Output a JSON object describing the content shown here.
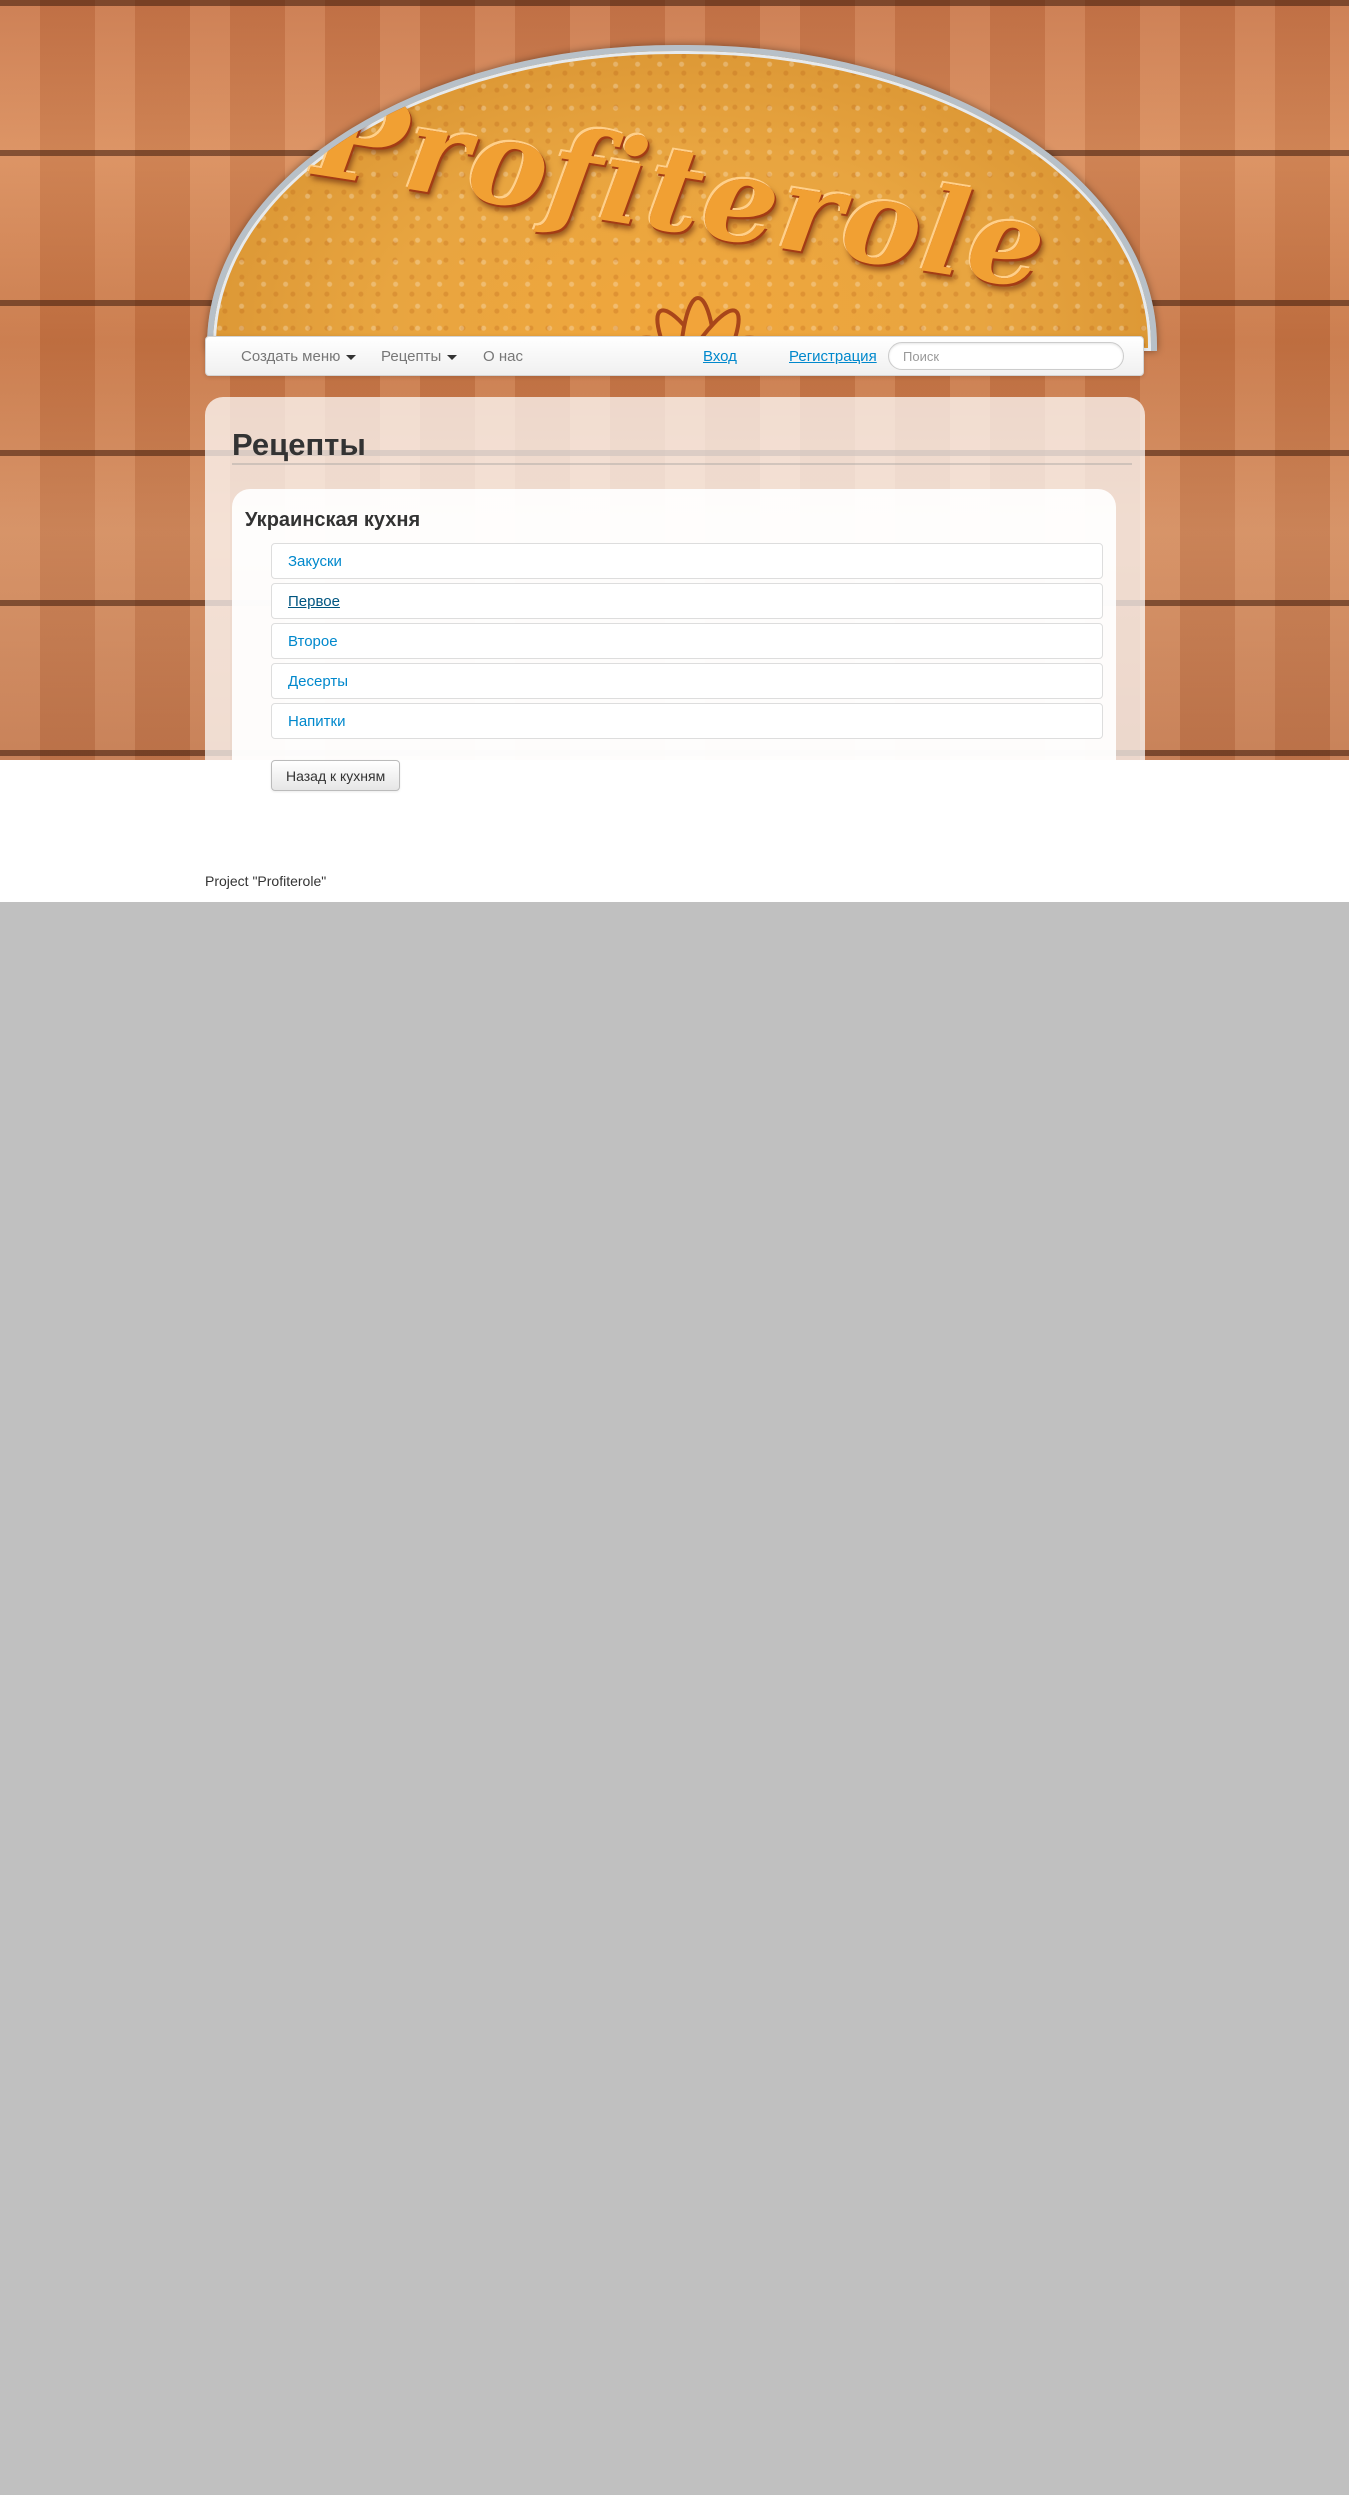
{
  "brand": {
    "logo_text": "Profiterole"
  },
  "navbar": {
    "items": [
      {
        "label": "Создать меню",
        "dropdown": true
      },
      {
        "label": "Рецепты",
        "dropdown": true
      },
      {
        "label": "О нас",
        "dropdown": false
      }
    ],
    "login_label": "Вход",
    "register_label": "Регистрация",
    "search_placeholder": "Поиск"
  },
  "main": {
    "title": "Рецепты",
    "cuisine_title": "Украинская кухня",
    "categories": [
      {
        "label": "Закуски",
        "active": false
      },
      {
        "label": "Первое",
        "active": true
      },
      {
        "label": "Второе",
        "active": false
      },
      {
        "label": "Десерты",
        "active": false
      },
      {
        "label": "Напитки",
        "active": false
      }
    ],
    "back_button_label": "Назад к кухням"
  },
  "footer": {
    "text": "Project \"Profiterole\""
  },
  "colors": {
    "link": "#0088cc",
    "link_active": "#005580",
    "page_background": "#c0c0c0"
  }
}
